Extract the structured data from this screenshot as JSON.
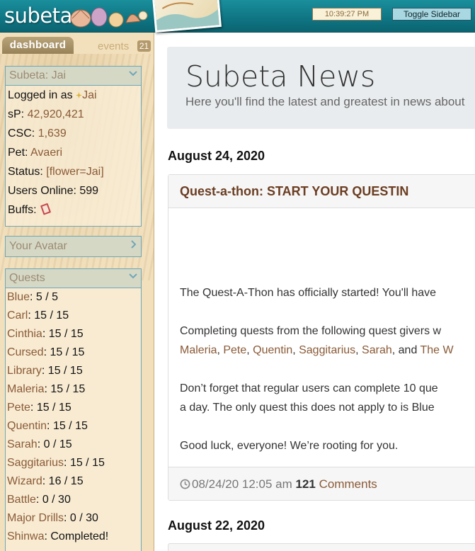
{
  "header": {
    "logo": "subeta",
    "clock": "10:39:27 PM",
    "toggle_sidebar": "Toggle Sidebar"
  },
  "sidebar": {
    "tabs": {
      "dashboard": "dashboard",
      "events": "events",
      "events_count": "21"
    },
    "user_panel": {
      "title": "Subeta: Jai",
      "logged_in_label": "Logged in as",
      "username": "Jai",
      "sp_label": "sP:",
      "sp_value": "42,920,421",
      "csc_label": "CSC:",
      "csc_value": "1,639",
      "pet_label": "Pet:",
      "pet_value": "Avaeri",
      "status_label": "Status:",
      "status_value": "[flower=Jai]",
      "users_online_label": "Users Online:",
      "users_online_value": "599",
      "buffs_label": "Buffs:"
    },
    "avatar_panel": {
      "title": "Your Avatar"
    },
    "quests_panel": {
      "title": "Quests",
      "items": [
        {
          "name": "Blue",
          "value": "5 / 5"
        },
        {
          "name": "Carl",
          "value": "15 / 15"
        },
        {
          "name": "Cinthia",
          "value": "15 / 15"
        },
        {
          "name": "Cursed",
          "value": "15 / 15"
        },
        {
          "name": "Library",
          "value": "15 / 15"
        },
        {
          "name": "Maleria",
          "value": "15 / 15"
        },
        {
          "name": "Pete",
          "value": "15 / 15"
        },
        {
          "name": "Quentin",
          "value": "15 / 15"
        },
        {
          "name": "Sarah",
          "value": "0 / 15"
        },
        {
          "name": "Saggitarius",
          "value": "15 / 15"
        },
        {
          "name": "Wizard",
          "value": "16 / 15"
        },
        {
          "name": "Battle",
          "value": "0 / 30"
        },
        {
          "name": "Major Drills",
          "value": "0 / 30"
        },
        {
          "name": "Shinwa",
          "value": "Completed!"
        }
      ]
    }
  },
  "main": {
    "news_title": "Subeta News",
    "news_subtitle": "Here you'll find the latest and greatest in news about",
    "dates": [
      "August 24, 2020",
      "August 22, 2020"
    ],
    "post": {
      "title": "Quest-a-thon: START YOUR QUESTIN",
      "p1": "The Quest-A-Thon has officially started! You'll have",
      "p2_line1": "Completing quests from the following quest givers w",
      "p2_links": [
        "Maleria",
        "Pete",
        "Quentin",
        "Saggitarius",
        "Sarah"
      ],
      "p2_and": "and",
      "p2_last_link": "The W",
      "p3_line1": "Don’t forget that regular users can complete 10 que",
      "p3_line2": "a day. The only quest this does not apply to is Blue",
      "p4": "Good luck, everyone! We’re rooting for you.",
      "timestamp": "08/24/20 12:05 am",
      "comment_count": "121",
      "comments_label": "Comments"
    }
  },
  "colors": {
    "header_teal": "#0f7482",
    "sidebar_bg": "#f2e0bd",
    "link_brown": "#8a5a37",
    "panel_border": "#6fa7b7"
  },
  "icons": [
    "chevron-down-icon",
    "chevron-right-icon",
    "clock-icon",
    "book-icon",
    "sparkle-icon"
  ]
}
